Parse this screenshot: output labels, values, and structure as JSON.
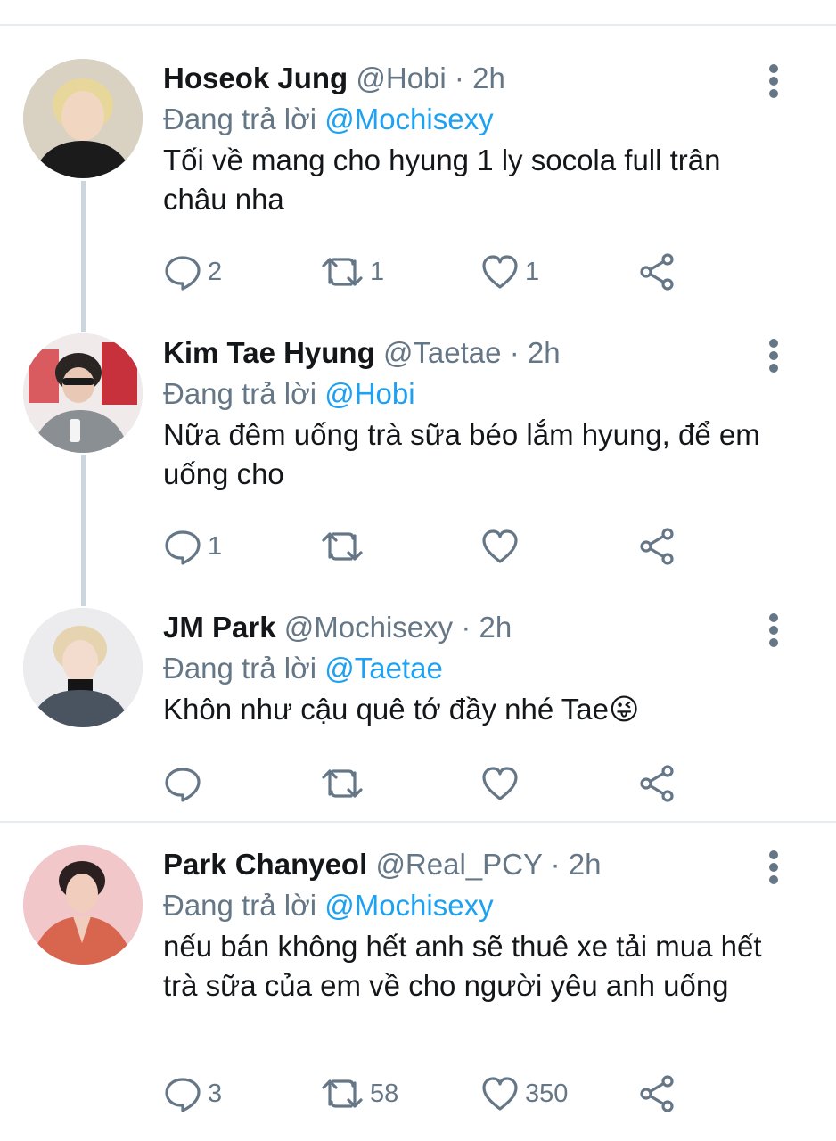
{
  "colors": {
    "accent": "#1da1f2",
    "secondary_text": "#657786",
    "divider": "#e6ecf0"
  },
  "tweets": [
    {
      "name": "Hoseok Jung",
      "handle": "@Hobi",
      "dot": "·",
      "time": "2h",
      "replying_prefix": "Đang trả lời",
      "replying_to": "@Mochisexy",
      "text": "Tối về mang cho hyung 1 ly socola full trân châu nha",
      "replies": "2",
      "retweets": "1",
      "likes": "1",
      "avatar_icon": "avatar-photo"
    },
    {
      "name": "Kim Tae Hyung",
      "handle": "@Taetae",
      "dot": "·",
      "time": "2h",
      "replying_prefix": "Đang trả lời",
      "replying_to": "@Hobi",
      "text": "Nữa đêm uống trà sữa béo lắm hyung, để em uống cho",
      "replies": "1",
      "retweets": "",
      "likes": "",
      "avatar_icon": "avatar-photo"
    },
    {
      "name": "JM Park",
      "handle": "@Mochisexy",
      "dot": "·",
      "time": "2h",
      "replying_prefix": "Đang trả lời",
      "replying_to": "@Taetae",
      "text": "Khôn như cậu quê tớ đầy nhé Tae😜",
      "replies": "",
      "retweets": "",
      "likes": "",
      "avatar_icon": "avatar-photo"
    },
    {
      "name": "Park Chanyeol",
      "handle": "@Real_PCY",
      "dot": "·",
      "time": "2h",
      "replying_prefix": "Đang trả lời",
      "replying_to": "@Mochisexy",
      "text": "nếu bán không hết anh sẽ thuê xe tải mua hết trà sữa của em về cho người yêu anh uống",
      "replies": "3",
      "retweets": "58",
      "likes": "350",
      "avatar_icon": "avatar-photo"
    }
  ]
}
